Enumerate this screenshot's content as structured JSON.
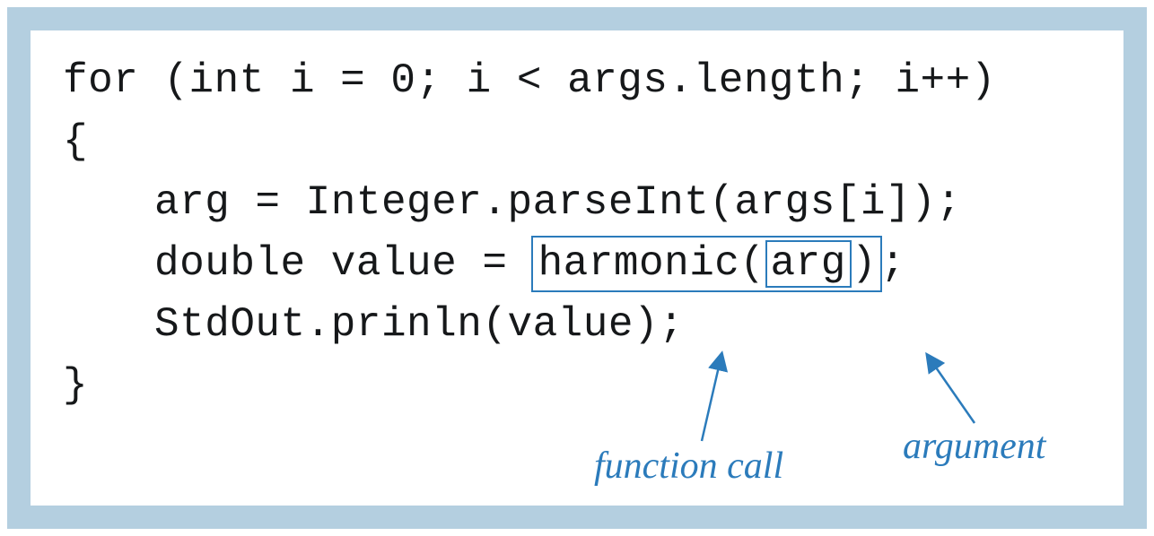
{
  "code": {
    "line1": "for (int i = 0; i < args.length; i++)",
    "line2": "{",
    "line3": "arg = Integer.parseInt(args[i]);",
    "line4_pre": "double value = ",
    "line4_call_fn": "harmonic(",
    "line4_call_arg": "arg",
    "line4_call_close": ")",
    "line4_post": ";",
    "line5": "StdOut.prinln(value);",
    "line6": "}"
  },
  "annotations": {
    "function_call": "function call",
    "argument": "argument"
  }
}
